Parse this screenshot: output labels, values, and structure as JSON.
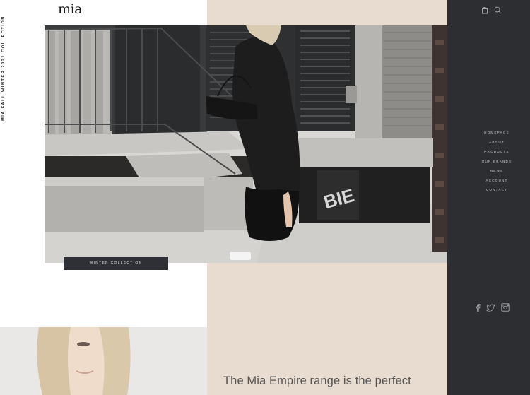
{
  "brand": {
    "logo": "mia"
  },
  "vertical_tag": "MIA FALL WINTER 2021 COLLECTION",
  "header_icons": [
    "shopping-bag-icon",
    "search-icon"
  ],
  "nav": {
    "items": [
      {
        "label": "HOMEPAGE"
      },
      {
        "label": "ABOUT"
      },
      {
        "label": "PRODUCTS"
      },
      {
        "label": "OUR BRANDS"
      },
      {
        "label": "NEWS"
      },
      {
        "label": "ACCOUNT"
      },
      {
        "label": "CONTACT"
      }
    ]
  },
  "social_icons": [
    "facebook-icon",
    "twitter-icon",
    "instagram-icon"
  ],
  "hero": {
    "cta_label": "WINTER COLLECTION",
    "wall_text": "BIE"
  },
  "tagline": "The Mia Empire range is the perfect",
  "colors": {
    "beige": "#e8dcd0",
    "side_panel": "#2d2e31",
    "cta_bg": "#2f3035"
  }
}
